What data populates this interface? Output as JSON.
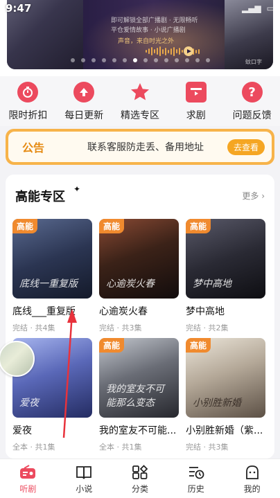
{
  "status": {
    "time": "9:47"
  },
  "banner": {
    "lines": [
      "即可解锁全部广播剧 · 无限畅听",
      "平仓爱情故事 · 小说广播剧",
      "声音，来自时光之外"
    ],
    "right_tag": "蚊口字"
  },
  "quick_actions": [
    {
      "label": "限时折扣",
      "icon": "stopwatch-icon"
    },
    {
      "label": "每日更新",
      "icon": "arrow-up-icon"
    },
    {
      "label": "精选专区",
      "icon": "star-icon"
    },
    {
      "label": "求剧",
      "icon": "film-icon"
    },
    {
      "label": "问题反馈",
      "icon": "question-icon"
    }
  ],
  "notice": {
    "tag": "公告",
    "text": "联系客服防走丢、备用地址",
    "button": "去查看"
  },
  "section": {
    "title": "高能专区",
    "more": "更多",
    "items": [
      {
        "title": "底线___重复版",
        "meta": "完结 · 共4集",
        "badge": "高能",
        "art": "底线一重复版",
        "colors": [
          "#3c4a6b",
          "#1a1f33"
        ]
      },
      {
        "title": "心逾炭火春",
        "meta": "完结 · 共3集",
        "badge": "高能",
        "art": "心逾炭火春",
        "colors": [
          "#6b3a2c",
          "#1f1414"
        ]
      },
      {
        "title": "梦中高地",
        "meta": "完结 · 共2集",
        "badge": "高能",
        "art": "梦中高地",
        "colors": [
          "#3a3a48",
          "#121216"
        ]
      },
      {
        "title": "爱夜",
        "meta": "全本 · 共1集",
        "badge": "",
        "art": "爱夜",
        "colors": [
          "#7b8fd6",
          "#2b3570"
        ]
      },
      {
        "title": "我的室友不可能...",
        "meta": "全本 · 共1集",
        "badge": "高能",
        "art": "我的室友不可能那么变态",
        "colors": [
          "#9aa0a8",
          "#3a3c44"
        ]
      },
      {
        "title": "小别胜新婚（紫...",
        "meta": "完结 · 共3集",
        "badge": "高能",
        "art": "小别胜新婚",
        "colors": [
          "#d8d0c0",
          "#6b5f52"
        ]
      }
    ]
  },
  "tabs": [
    {
      "label": "听剧",
      "icon": "radio-icon",
      "active": true
    },
    {
      "label": "小说",
      "icon": "book-icon",
      "active": false
    },
    {
      "label": "分类",
      "icon": "category-icon",
      "active": false
    },
    {
      "label": "历史",
      "icon": "history-icon",
      "active": false
    },
    {
      "label": "我的",
      "icon": "profile-icon",
      "active": false
    }
  ]
}
